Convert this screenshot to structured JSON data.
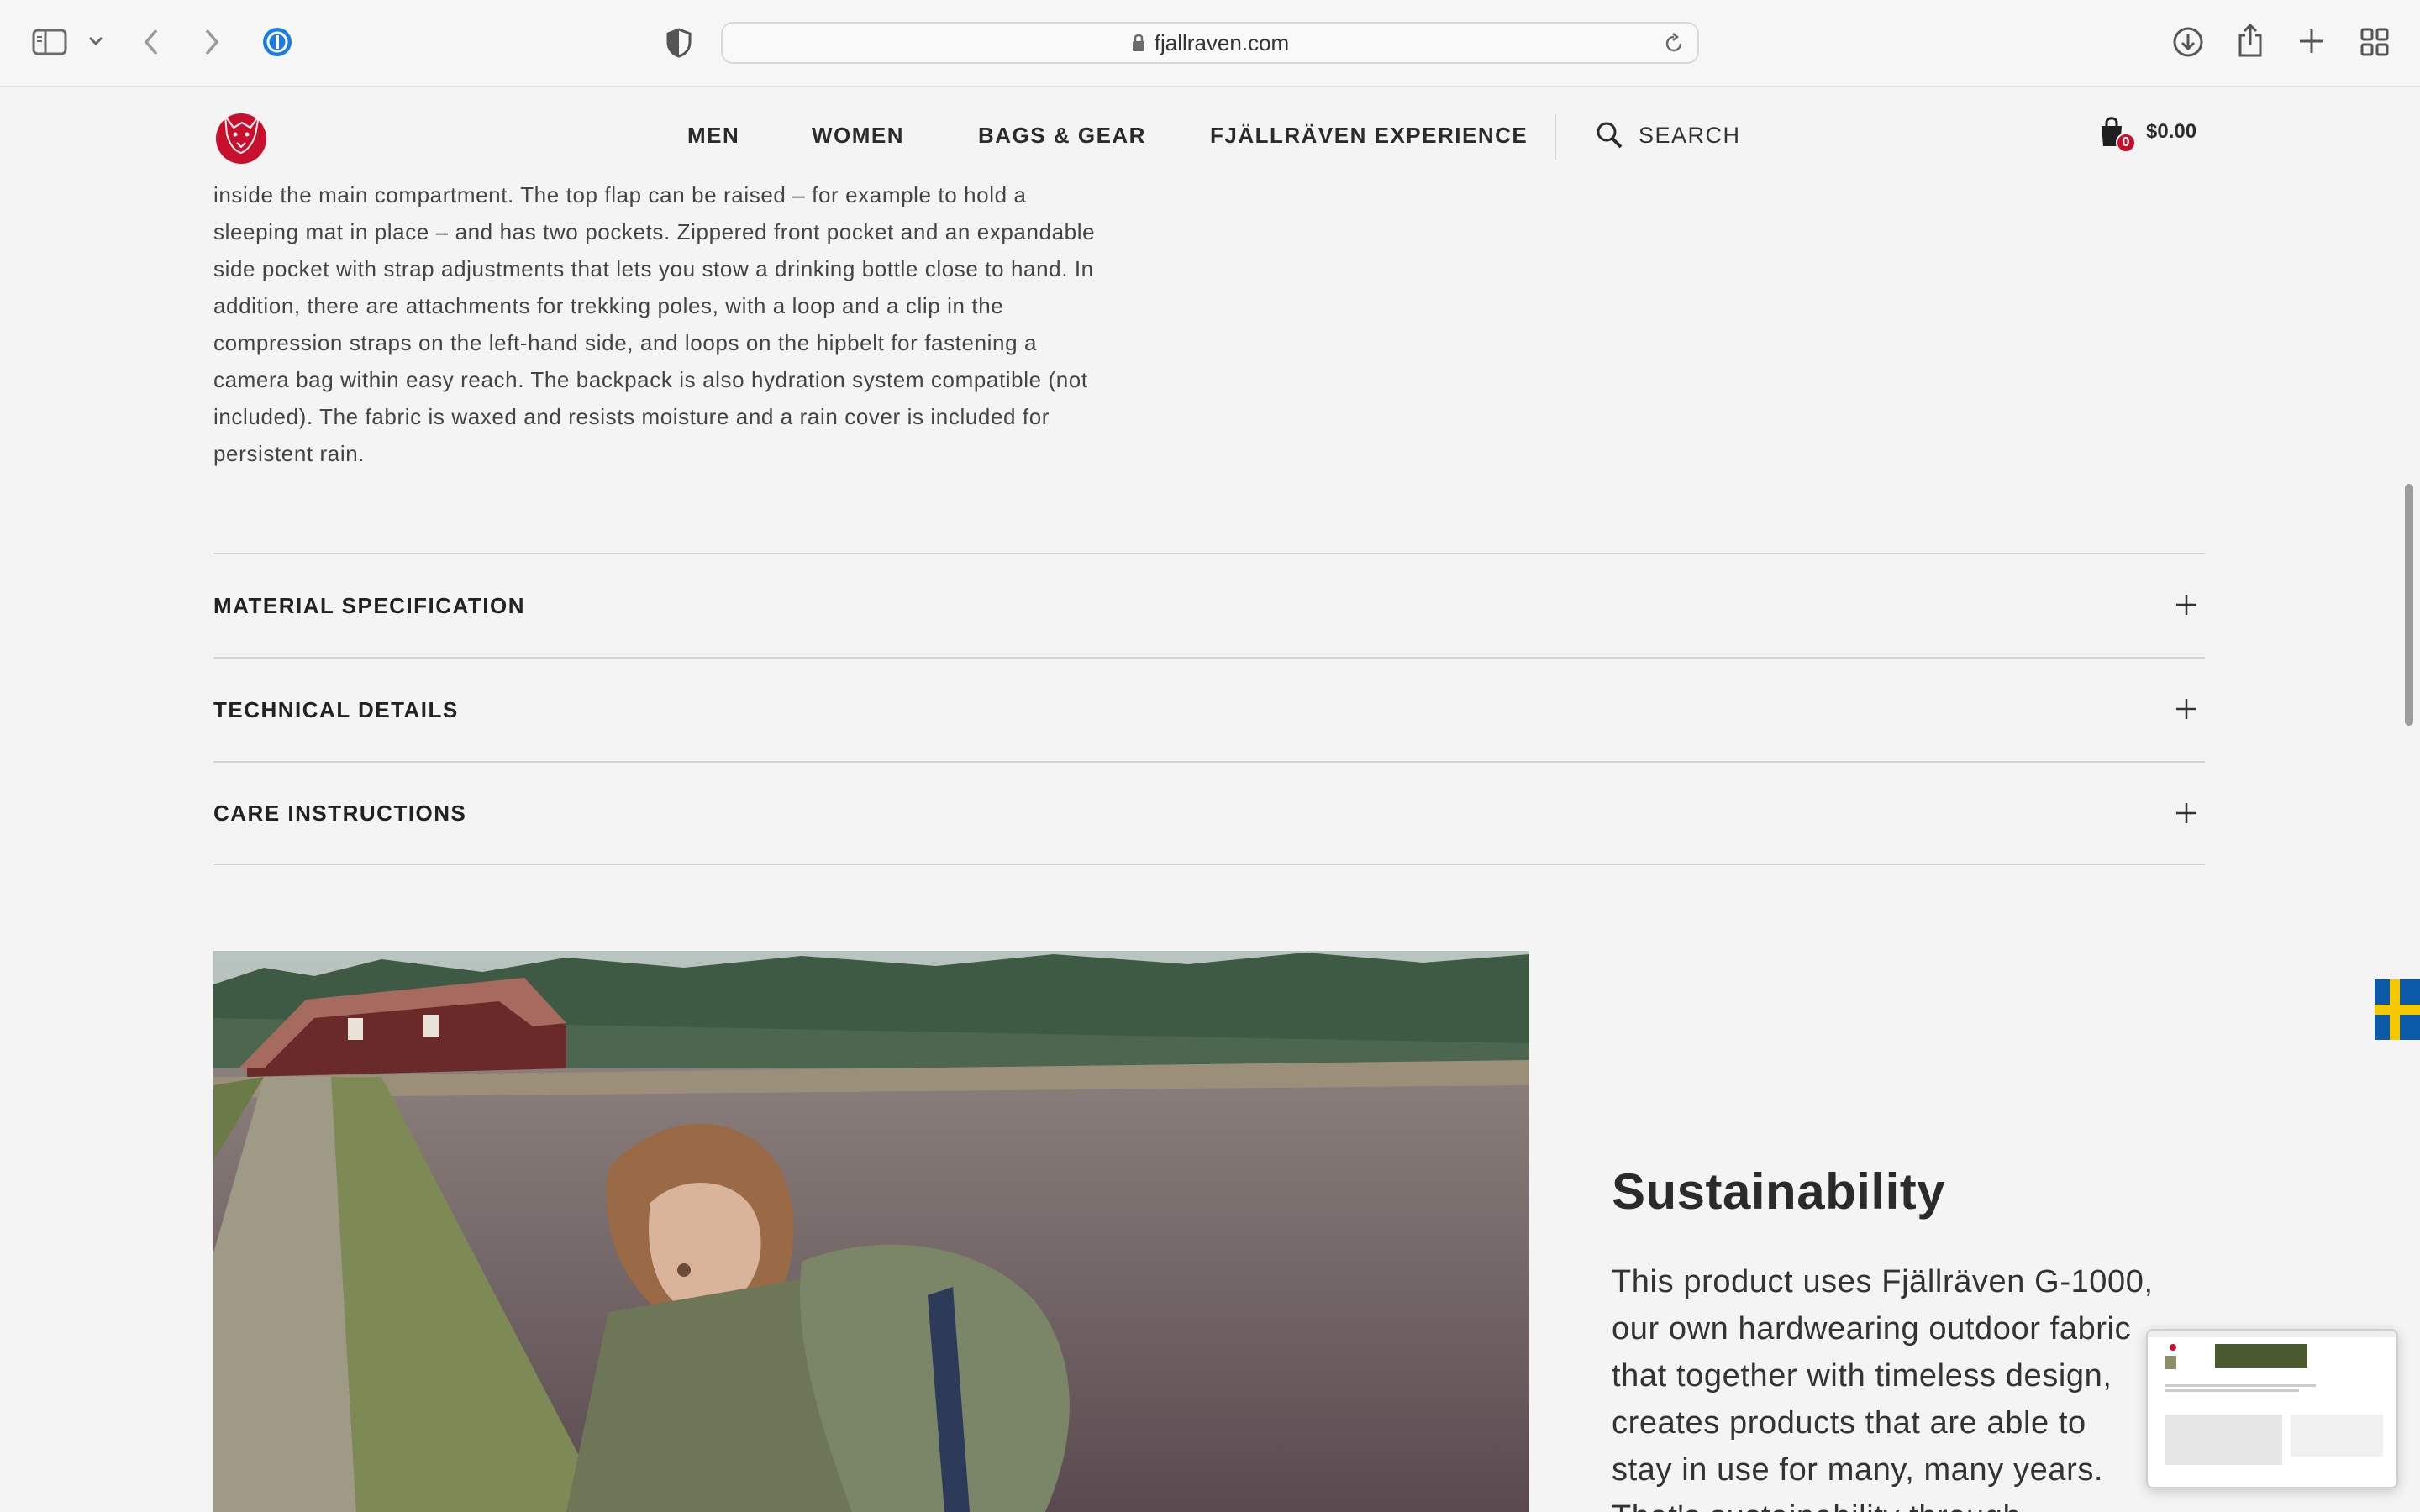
{
  "browser": {
    "url": "fjallraven.com"
  },
  "header": {
    "nav": [
      "MEN",
      "WOMEN",
      "BAGS & GEAR",
      "FJÄLLRÄVEN EXPERIENCE"
    ],
    "search_label": "SEARCH",
    "cart_count": "0",
    "cart_total": "$0.00"
  },
  "description": {
    "lines": [
      "inside the main compartment. The top flap can be raised – for example to hold a",
      "sleeping mat in place – and has two pockets. Zippered front pocket and an expandable",
      "side pocket with strap adjustments that lets you stow a drinking bottle close to hand. In",
      "addition, there are attachments for trekking poles, with a loop and a clip in the",
      "compression straps on the left-hand side, and loops on the hipbelt for fastening a",
      "camera bag within easy reach. The backpack is also hydration system compatible (not",
      "included). The fabric is waxed and resists moisture and a rain cover is included for",
      "persistent rain."
    ]
  },
  "accordion": [
    {
      "label": "MATERIAL SPECIFICATION"
    },
    {
      "label": "TECHNICAL DETAILS"
    },
    {
      "label": "CARE INSTRUCTIONS"
    }
  ],
  "sustainability": {
    "title": "Sustainability",
    "lines": [
      "This product uses Fjällräven G-1000,",
      "our own hardwearing outdoor fabric",
      "that together with timeless design,",
      "creates products that are able to",
      "stay in use for many, many years.",
      "That's sustainability through"
    ]
  },
  "colors": {
    "brand_red": "#c8102e",
    "background": "#f4f4f4"
  }
}
